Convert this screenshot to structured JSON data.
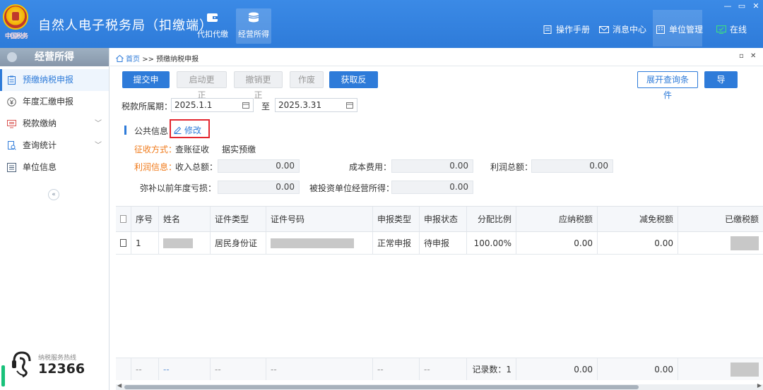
{
  "header": {
    "logo_text": "中国税务",
    "app_title": "自然人电子税务局（扣缴端）",
    "nav": [
      {
        "label": "代扣代缴",
        "icon": "wallet-icon"
      },
      {
        "label": "经营所得",
        "icon": "coins-icon"
      }
    ],
    "links": {
      "manual": "操作手册",
      "messages": "消息中心",
      "unit_mgmt": "单位管理",
      "online": "在线"
    },
    "colors": {
      "header_bg": "#2e7bd9",
      "online": "#3ddc84"
    }
  },
  "sidebar": {
    "title": "经营所得",
    "items": [
      {
        "label": "预缴纳税申报",
        "icon": "clipboard-icon"
      },
      {
        "label": "年度汇缴申报",
        "icon": "yen-icon"
      },
      {
        "label": "税款缴纳",
        "icon": "monitor-icon"
      },
      {
        "label": "查询统计",
        "icon": "search-doc-icon"
      },
      {
        "label": "单位信息",
        "icon": "list-icon"
      }
    ],
    "collapse": "«",
    "hotline_label": "纳税服务热线",
    "hotline_number": "12366"
  },
  "breadcrumb": {
    "home": "首页",
    "sep": ">>",
    "current": "预缴纳税申报"
  },
  "toolbar": {
    "submit": "提交申报",
    "start_correct": "启动更正",
    "cancel_correct": "撤销更正",
    "void": "作废",
    "get_feedback": "获取反馈",
    "expand_query": "展开查询条件",
    "export": "导出"
  },
  "period": {
    "label": "税款所属期：",
    "start": "2025.1.1",
    "to": "至",
    "end": "2025.3.31"
  },
  "public_info": {
    "title": "公共信息",
    "edit": "修改",
    "collection_method_label": "征收方式：",
    "collection_method_value": "查账征收",
    "prepay_basis": "据实预缴",
    "profit_info_label": "利润信息：",
    "total_income_label": "收入总额：",
    "total_income": "0.00",
    "cost_label": "成本费用：",
    "cost": "0.00",
    "total_profit_label": "利润总额：",
    "total_profit": "0.00",
    "loss_offset_label": "弥补以前年度亏损：",
    "loss_offset": "0.00",
    "investee_income_label": "被投资单位经营所得：",
    "investee_income": "0.00"
  },
  "table": {
    "headers": [
      "序号",
      "姓名",
      "证件类型",
      "证件号码",
      "申报类型",
      "申报状态",
      "分配比例",
      "应纳税额",
      "减免税额",
      "已缴税额"
    ],
    "rows": [
      {
        "seq": "1",
        "name": "",
        "id_type": "居民身份证",
        "id_number": "",
        "decl_type": "正常申报",
        "decl_status": "待申报",
        "ratio": "100.00%",
        "tax_payable": "0.00",
        "tax_reduction": "0.00"
      }
    ],
    "footer": {
      "seq": "--",
      "name": "--",
      "id_type": "--",
      "id_number": "--",
      "decl_type": "--",
      "decl_status": "--",
      "record_count": "记录数：1",
      "tax_payable": "0.00",
      "tax_reduction": "0.00"
    }
  }
}
